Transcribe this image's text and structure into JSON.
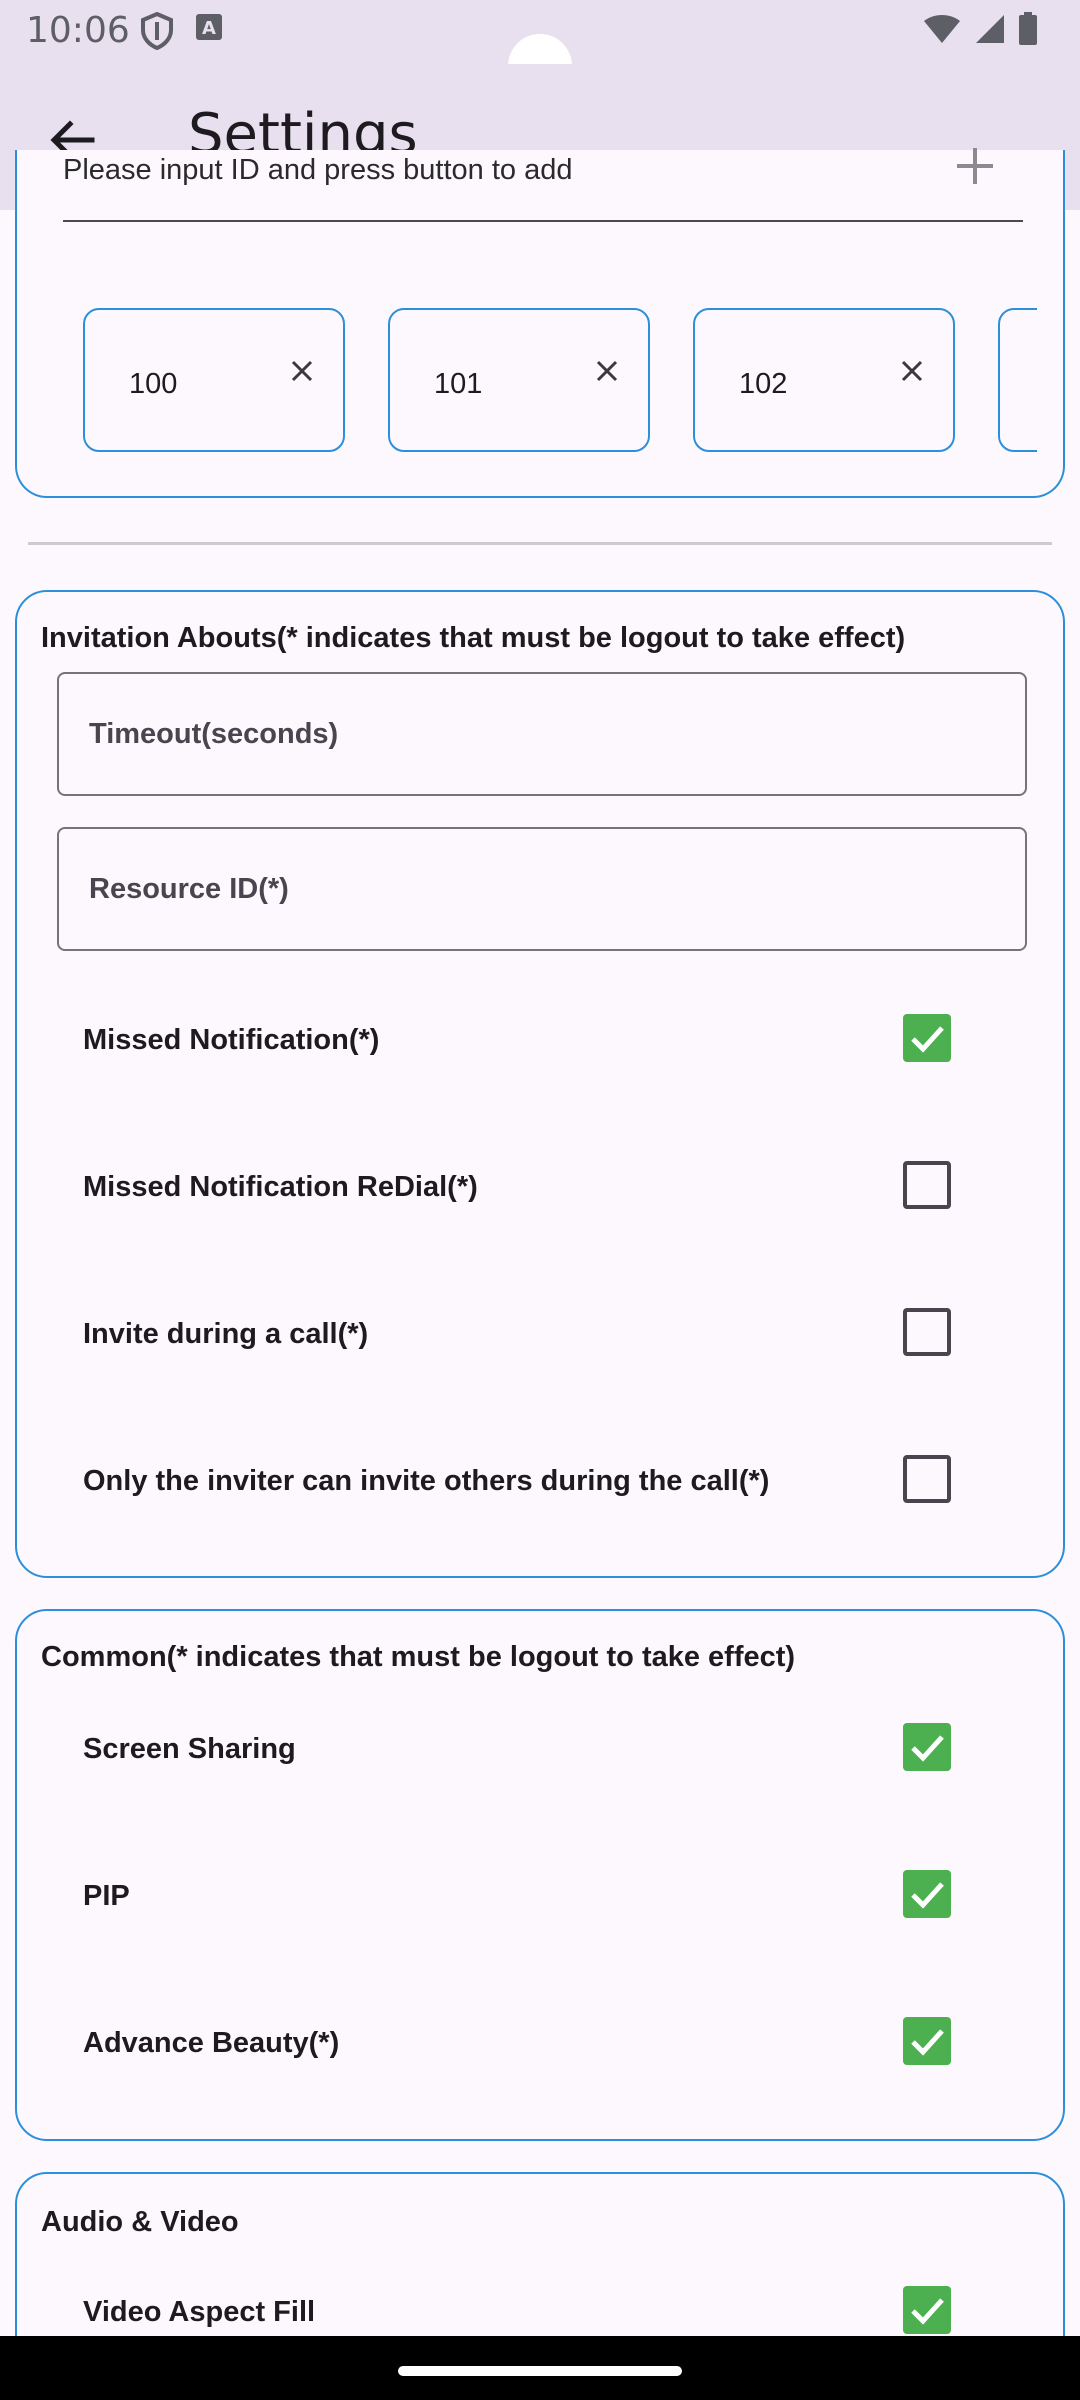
{
  "status_bar": {
    "time": "10:06"
  },
  "app_bar": {
    "title": "Settings"
  },
  "id_section": {
    "placeholder": "Please input ID and press button to add",
    "chips": [
      "100",
      "101",
      "102"
    ]
  },
  "invitation": {
    "title": "Invitation Abouts(* indicates that must be logout to take effect)",
    "fields": [
      {
        "label": "Timeout(seconds)"
      },
      {
        "label": "Resource ID(*)"
      }
    ],
    "options": [
      {
        "label": "Missed Notification(*)",
        "checked": true
      },
      {
        "label": "Missed Notification ReDial(*)",
        "checked": false
      },
      {
        "label": "Invite during a call(*)",
        "checked": false
      },
      {
        "label": "Only the inviter can invite others during the call(*)",
        "checked": false
      }
    ]
  },
  "common": {
    "title": "Common(* indicates that must be logout to take effect)",
    "options": [
      {
        "label": "Screen Sharing",
        "checked": true
      },
      {
        "label": "PIP",
        "checked": true
      },
      {
        "label": "Advance Beauty(*)",
        "checked": true
      }
    ]
  },
  "audio_video": {
    "title": "Audio & Video",
    "options": [
      {
        "label": "Video Aspect Fill",
        "checked": true
      }
    ]
  },
  "colors": {
    "accent_border": "#2c8fdc",
    "checkbox_checked": "#4caf50",
    "app_bar_bg": "#e8e0ef"
  }
}
